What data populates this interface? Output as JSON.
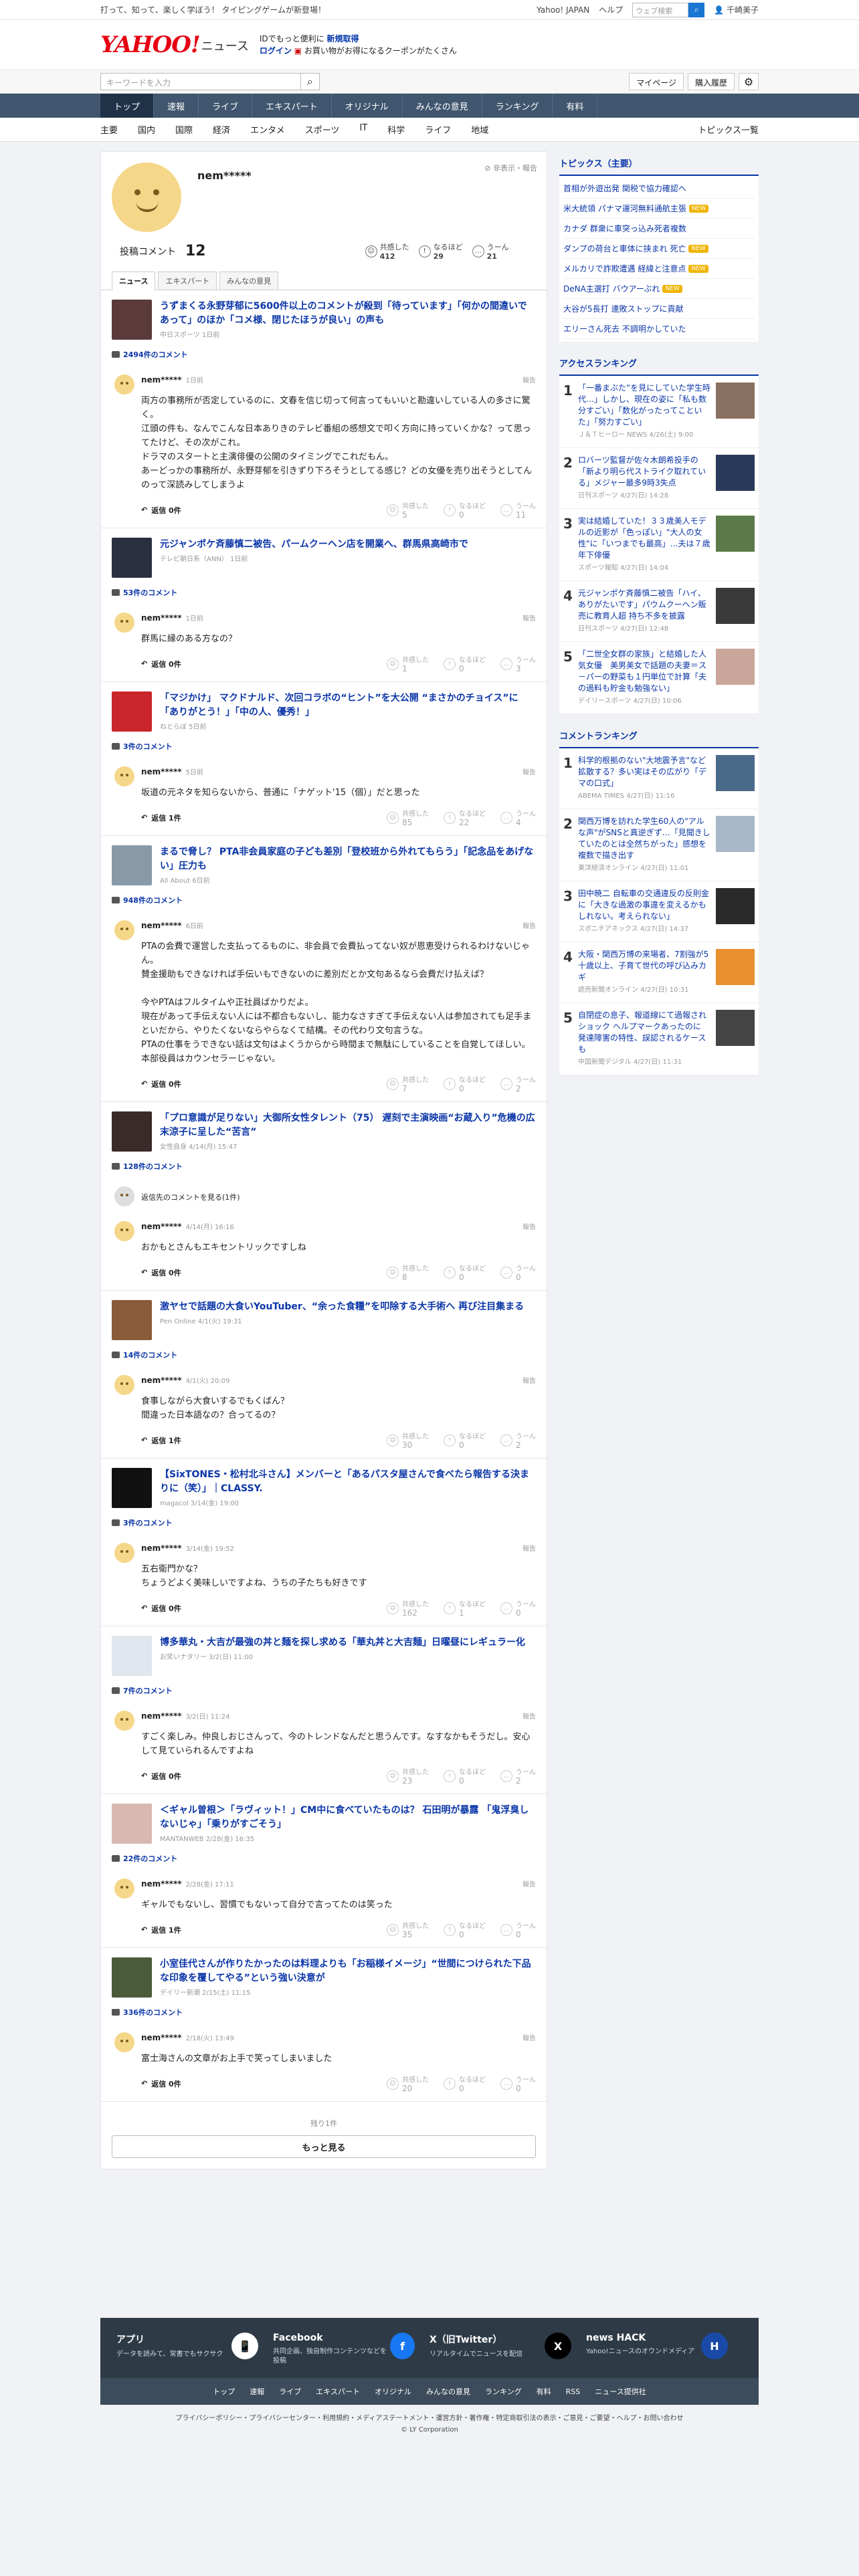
{
  "topbar": {
    "left": "打って、知って、楽しく学ぼう！ タイピングゲームが新登場！",
    "links": [
      "Yahoo! JAPAN",
      "ヘルプ"
    ],
    "search_placeholder": "ウェブ検索",
    "user": "千崎美子"
  },
  "brand": {
    "logo": "YAHOO!",
    "logo_sub": "JAPAN",
    "section": "ニュース",
    "promo_line1a": "IDでもっと便利に",
    "promo_line1b": "新規取得",
    "promo_line2a": "ログイン",
    "promo_line2b": "お買い物がお得になるクーポンがたくさん"
  },
  "search": {
    "placeholder": "キーワードを入力",
    "mypage": "マイページ",
    "history": "購入履歴"
  },
  "gnav": [
    "トップ",
    "速報",
    "ライブ",
    "エキスパート",
    "オリジナル",
    "みんなの意見",
    "ランキング",
    "有料"
  ],
  "snav": {
    "items": [
      "主要",
      "国内",
      "国際",
      "経済",
      "エンタメ",
      "スポーツ",
      "IT",
      "科学",
      "ライフ",
      "地域"
    ],
    "right": "トピックス一覧"
  },
  "profile": {
    "name": "nem*****",
    "side": "非表示・報告",
    "comments_label": "投稿コメント",
    "comments": "12",
    "reactions": [
      {
        "label": "共感した",
        "count": "412",
        "icon": "☺"
      },
      {
        "label": "なるほど",
        "count": "29",
        "icon": "!"
      },
      {
        "label": "うーん",
        "count": "21",
        "icon": "…"
      }
    ],
    "tabs": [
      "ニュース",
      "エキスパート",
      "みんなの意見"
    ]
  },
  "vote_labels": {
    "like": "共感した",
    "hmm": "なるほど",
    "umm": "うーん"
  },
  "cards": [
    {
      "title": "うずまくる永野芽郁に5600件以上のコメントが殺到「待っています」「何かの間違いであって」のほか「コメ様、閉じたほうが良い」の声も",
      "src": "中日スポーツ 1日前",
      "count": "2494件のコメント",
      "user": "nem*****",
      "date": "1日前",
      "report": "報告",
      "text": "両方の事務所が否定しているのに、文春を信じ切って何言ってもいいと勘違いしている人の多さに驚く。\n江頭の件も、なんでこんな日本ありきのテレビ番組の感想文で叩く方向に持っていくかな？って思ってたけど、その次がこれ。\nドラマのスタートと主演俳優の公開のタイミングでこれだもん。\nあーどっかの事務所が、永野芽郁を引きずり下ろそうとしてる感じ？どの女優を売り出そうとしてんのって深読みしてしまうよ",
      "reply": "返信 0件",
      "v": [
        "5",
        "0",
        "11"
      ],
      "thumb": "#5a3a3a"
    },
    {
      "title": "元ジャンポケ斉藤慎二被告、パームクーヘン店を開業へ、群馬県高崎市で",
      "src": "テレビ朝日系（ANN） 1日前",
      "count": "53件のコメント",
      "user": "nem*****",
      "date": "1日前",
      "report": "報告",
      "text": "群馬に縁のある方なの？",
      "reply": "返信 0件",
      "v": [
        "1",
        "0",
        "3"
      ],
      "thumb": "#2a3040"
    },
    {
      "title": "「マジかけ」 マクドナルド、次回コラボの“ヒント”を大公開 “まさかのチョイス”に「ありがとう！」「中の人、優秀！」",
      "src": "ねとらぼ 5日前",
      "count": "3件のコメント",
      "user": "nem*****",
      "date": "5日前",
      "report": "報告",
      "text": "坂道の元ネタを知らないから、普通に「ナゲット'15（個）」だと思った",
      "reply": "返信 1件",
      "v": [
        "85",
        "22",
        "4"
      ],
      "thumb": "#c8262a"
    },
    {
      "title": "まるで脅し？ PTA非会員家庭の子ども差別「登校班から外れてもらう」「記念品をあげない」圧力も",
      "src": "All About 6日前",
      "count": "948件のコメント",
      "user": "nem*****",
      "date": "6日前",
      "report": "報告",
      "text": "PTAの会費で運営した支払ってるものに、非会員で会費払ってない奴が恩恵受けられるわけないじゃん。\n賛金援助もできなければ手伝いもできないのに差別だとか文句あるなら会費だけ払えば？\n\n今やPTAはフルタイムや正社員ばかりだよ。\n現在があって手伝えない人には不都合もないし、能力なさすぎて手伝えない人は参加されても足手まといだから、やりたくないならやらなくて結構。その代わり文句言うな。\nPTAの仕事をうできない話は文句はよくうからから時間まで無駄にしていることを自覚してほしい。本部役員はカウンセラーじゃない。",
      "reply": "返信 0件",
      "v": [
        "7",
        "0",
        "2"
      ],
      "thumb": "#8899a8"
    },
    {
      "title": "「プロ意識が足りない」大御所女性タレント（75） 遅刻で主演映画“お蔵入り”危機の広末涼子に呈した“苦言”",
      "src": "女性自身 4/14(月) 15:47",
      "count": "128件のコメント",
      "preview": "返信先のコメントを見る(1件)",
      "user": "nem*****",
      "date": "4/14(月) 16:16",
      "report": "報告",
      "text": "おかもとさんもエキセントリックですしね",
      "reply": "返信 0件",
      "v": [
        "8",
        "0",
        "0"
      ],
      "thumb": "#3a2a2a"
    },
    {
      "title": "激ヤセで話題の大食いYouTuber、“余った食糧”を叩除する大手術へ 再び注目集まる",
      "src": "Pen Online 4/1(火) 19:31",
      "count": "14件のコメント",
      "user": "nem*****",
      "date": "4/1(火) 20:09",
      "report": "報告",
      "text": "食事しながら大食いするでもくばん？\n間違った日本語なの？合ってるの？",
      "reply": "返信 1件",
      "v": [
        "30",
        "0",
        "2"
      ],
      "thumb": "#8a5a3a"
    },
    {
      "title": "【SixTONES・松村北斗さん】メンバーと「あるパスタ屋さんで食べたら報告する決まりに（笑）」｜CLASSY.",
      "src": "magacol 3/14(金) 19:00",
      "count": "3件のコメント",
      "user": "nem*****",
      "date": "3/14(金) 19:52",
      "report": "報告",
      "text": "五右衛門かな？\nちょうどよく美味しいですよね、うちの子たちも好きです",
      "reply": "返信 0件",
      "v": [
        "162",
        "1",
        "0"
      ],
      "thumb": "#111111"
    },
    {
      "title": "博多華丸・大吉が最強の丼と麺を探し求める「華丸丼と大吉麺」日曜昼にレギュラー化",
      "src": "お笑いナタリー 3/2(日) 11:00",
      "count": "7件のコメント",
      "user": "nem*****",
      "date": "3/2(日) 11:24",
      "report": "報告",
      "text": "すごく楽しみ。仲良しおじさんって、今のトレンドなんだと思うんです。なすなかもそうだし。安心して見ていられるんですよね",
      "reply": "返信 0件",
      "v": [
        "23",
        "0",
        "2"
      ],
      "thumb": "#dfe6ee"
    },
    {
      "title": "＜ギャル曽根＞「ラヴィット！」CM中に食べていたものは？ 石田明が暴露 「鬼浮臭しないじゃ」「乗りがすごそう」",
      "src": "MANTANWEB 2/28(金) 16:35",
      "count": "22件のコメント",
      "user": "nem*****",
      "date": "2/28(金) 17:11",
      "report": "報告",
      "text": "ギャルでもないし、習慣でもないって自分で言ってたのは笑った",
      "reply": "返信 1件",
      "v": [
        "35",
        "0",
        "0"
      ],
      "thumb": "#d8b8b0"
    },
    {
      "title": "小室佳代さんが作りたかったのは料理よりも「お稲様イメージ」“世間につけられた下品な印象を覆してやる”という強い決意が",
      "src": "デイリー新潮 2/15(土) 11:15",
      "count": "336件のコメント",
      "user": "nem*****",
      "date": "2/18(火) 13:49",
      "report": "報告",
      "text": "富士海さんの文章がお上手で笑ってしまいました",
      "reply": "返信 0件",
      "v": [
        "20",
        "0",
        "0"
      ],
      "thumb": "#4a5a3a"
    }
  ],
  "more": {
    "remaining": "残り1件",
    "button": "もっと見る"
  },
  "right": {
    "topics_head": "トピックス（主要）",
    "topics": [
      {
        "t": "首相が外遊出発 関税で協力確認へ",
        "n": false
      },
      {
        "t": "米大統領 パナマ運河無料通航主張",
        "n": true
      },
      {
        "t": "カナダ 群衆に車突っ込み死者複数",
        "n": false
      },
      {
        "t": "ダンプの荷台と車体に挟まれ 死亡",
        "n": true
      },
      {
        "t": "メルカリで詐欺遭遇 経緯と注意点",
        "n": true
      },
      {
        "t": "DeNA主選打 バウアーぶれ",
        "n": true
      },
      {
        "t": "大谷が5長打 連敗ストップに貢献",
        "n": false
      },
      {
        "t": "エリーさん死去 不調明かしていた",
        "n": false
      }
    ],
    "access_head": "アクセスランキング",
    "access": [
      {
        "t": "「一番まぶた“を見にしていた学生時代…」しかし、現在の姿に「私も数分すごい」「数化がったってこといた」「努力すごい」",
        "s": "Ｊ＆Ｔヒーロー NEWS 4/26(土) 9:00",
        "c": "#8a7060"
      },
      {
        "t": "ロバーツ監督が佐々木朗希投手の「新より明ら代ストライク取れている」メジャー最多9時3失点",
        "s": "日刊スポーツ 4/27(日) 14:28",
        "c": "#2a3a5a"
      },
      {
        "t": "実は結婚していた！３３歳美人モデルの近影が「色っぽい」\"大人の女性\"に「いつまでも最高」…夫は７歳年下俳優",
        "s": "スポーツ報知 4/27(日) 14:04",
        "c": "#5a7a4a"
      },
      {
        "t": "元ジャンポケ斉藤慎二被告「ハイ、ありがたいです」パウムクーヘン販売に教育人超 持ち不多を披露",
        "s": "日刊スポーツ 4/27(日) 12:48",
        "c": "#3a3a3a"
      },
      {
        "t": "「二世全女群の家族」と結婚した人気女優　美男美女で話題の夫妻＝ス－パーの野菜も１円単位で計算「夫の過料も貯金も勉強ない」",
        "s": "デイリースポーツ 4/27(日) 10:06",
        "c": "#c9a59a"
      }
    ],
    "comment_head": "コメントランキング",
    "comment": [
      {
        "t": "科学的根拠のない\"大地震予言\"など拡散する？多い実はその広がり「デマの口式」",
        "s": "ABEMA TIMES 4/27(日) 11:16",
        "c": "#4a6a8a"
      },
      {
        "t": "関西万博を訪れた学生60人の\"アルな声\"がSNSと真逆ぎず…「見聞きしていたのとは全然ちがった」感想を複数で描き出す",
        "s": "東洋経済オンライン 4/27(日) 11:01",
        "c": "#a8b8c8"
      },
      {
        "t": "田中暁二 自転車の交通違反の反則金に「大きな過激の事違を変えるかもしれない。考えられない」",
        "s": "スポニチアネックス 4/27(日) 14:37",
        "c": "#2a2a2a"
      },
      {
        "t": "大阪・関西万博の来場者、7割強が5十歳以上、子育て世代の呼び込みカギ",
        "s": "読売新聞オンライン 4/27(日) 10:31",
        "c": "#e89030"
      },
      {
        "t": "自閉症の息子、報道線にて過報されショック ヘルプマークあったのに 発達障害の特性、誤認されるケースも",
        "s": "中国新聞デジタル 4/27(日) 11:31",
        "c": "#444444"
      }
    ]
  },
  "footer": {
    "cols": [
      {
        "h": "アプリ",
        "p": "データを読みて、常書でもサクサク",
        "icon": "📱"
      },
      {
        "h": "Facebook",
        "p": "共同企画、独自制作コンテンツなどを投稿",
        "icon": "f"
      },
      {
        "h": "X（旧Twitter）",
        "p": "リアルタイムでニュースを配信",
        "icon": "X"
      },
      {
        "h": "news HACK",
        "p": "Yahoo!ニュースのオウンドメディア",
        "icon": "H"
      }
    ],
    "nav": [
      "トップ",
      "速報",
      "ライブ",
      "エキスパート",
      "オリジナル",
      "みんなの意見",
      "ランキング",
      "有料",
      "RSS",
      "ニュース提供社"
    ],
    "legal": "プライバシーポリシー・プライバシーセンター・利用規約・メディアステートメント・運営方針・著作権・特定商取引法の表示・ご意見・ご要望・ヘルプ・お問い合わせ",
    "copy": "© LY Corporation"
  }
}
